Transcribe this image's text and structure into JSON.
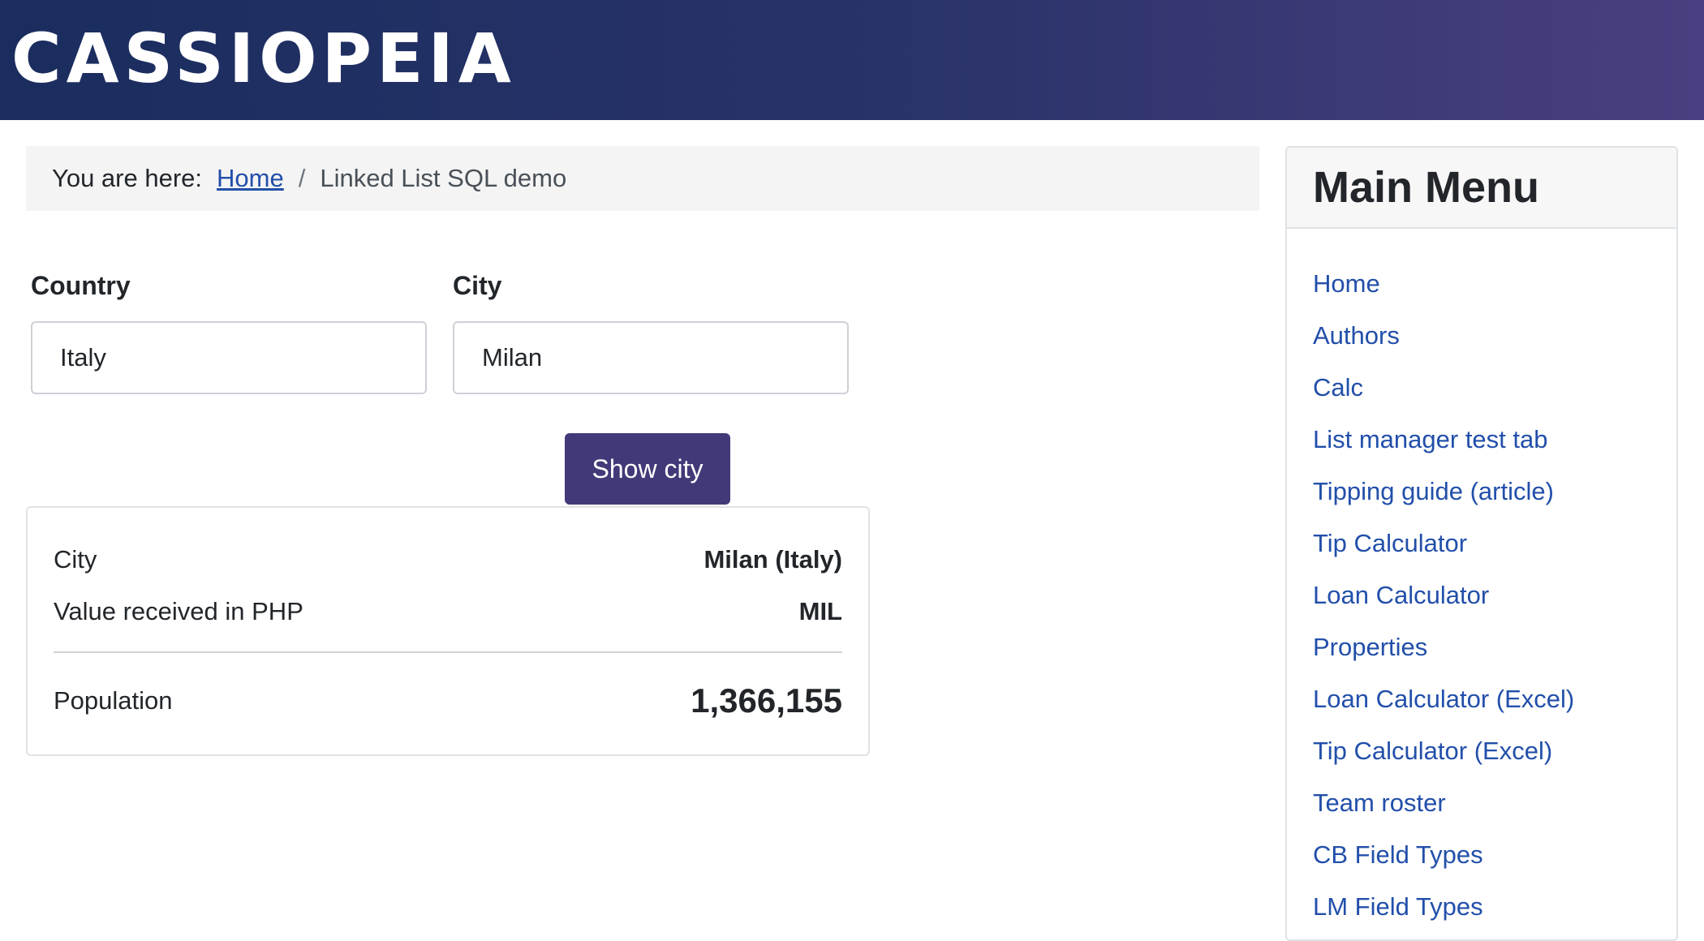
{
  "header": {
    "brand": "CASSIOPEIA"
  },
  "breadcrumb": {
    "prefix": "You are here:",
    "home": "Home",
    "separator": "/",
    "current": "Linked List SQL demo"
  },
  "form": {
    "country_label": "Country",
    "country_value": "Italy",
    "city_label": "City",
    "city_value": "Milan",
    "submit_label": "Show city"
  },
  "result": {
    "city_label": "City",
    "city_value": "Milan (Italy)",
    "php_label": "Value received in PHP",
    "php_value": "MIL",
    "population_label": "Population",
    "population_value": "1,366,155"
  },
  "menu": {
    "title": "Main Menu",
    "items": [
      "Home",
      "Authors",
      "Calc",
      "List manager test tab",
      "Tipping guide (article)",
      "Tip Calculator",
      "Loan Calculator",
      "Properties",
      "Loan Calculator (Excel)",
      "Tip Calculator (Excel)",
      "Team roster",
      "CB Field Types",
      "LM Field Types"
    ]
  },
  "colors": {
    "header_start": "#1a2d5e",
    "header_end": "#4a3f80",
    "button": "#423a78",
    "link": "#224faa"
  }
}
